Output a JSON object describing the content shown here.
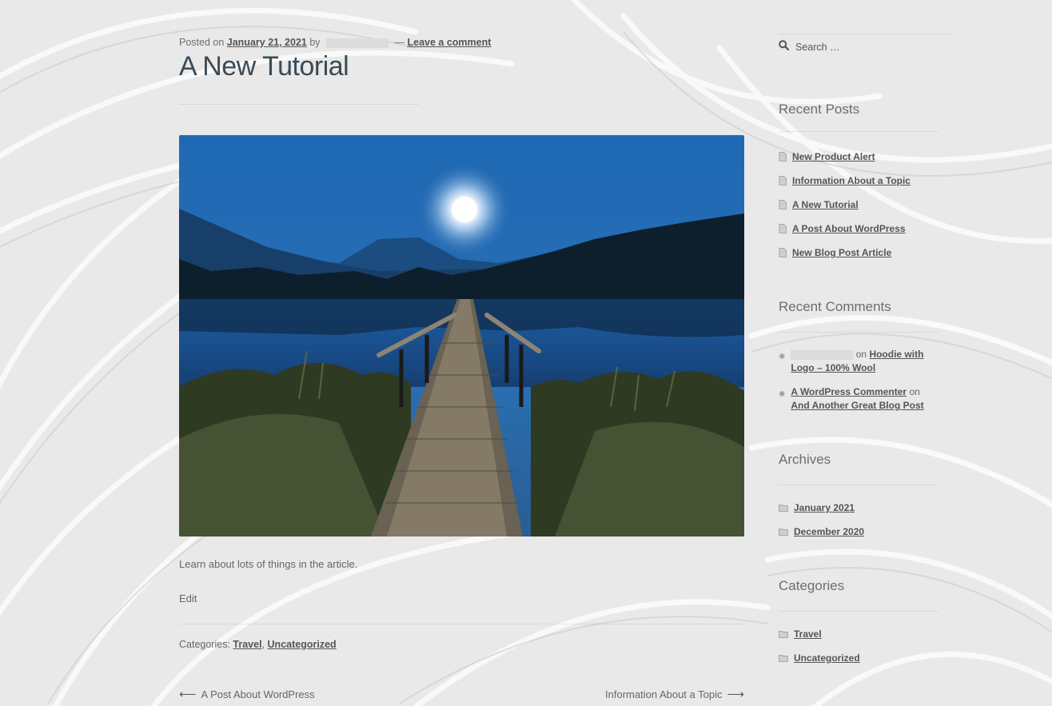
{
  "post": {
    "meta": {
      "posted_on": "Posted on",
      "date": "January 21, 2021",
      "by": "by",
      "dash": "—",
      "comment_link": "Leave a comment"
    },
    "title": "A New Tutorial",
    "excerpt": "Learn about lots of things in the article.",
    "edit_label": "Edit",
    "categories_label": "Categories:",
    "categories": [
      "Travel",
      "Uncategorized"
    ],
    "categories_sep": ",",
    "nav": {
      "prev_label": "A Post About WordPress",
      "next_label": "Information About a Topic"
    }
  },
  "sidebar": {
    "search": {
      "placeholder": "Search …"
    },
    "recent_posts": {
      "title": "Recent Posts",
      "items": [
        "New Product Alert",
        "Information About a Topic",
        "A New Tutorial",
        "A Post About WordPress",
        "New Blog Post Article"
      ]
    },
    "recent_comments": {
      "title": "Recent Comments",
      "on": "on",
      "items": [
        {
          "author": "",
          "post": "Hoodie with Logo – 100% Wool"
        },
        {
          "author": "A WordPress Commenter",
          "post": "And Another Great Blog Post"
        }
      ]
    },
    "archives": {
      "title": "Archives",
      "items": [
        "January 2021",
        "December 2020"
      ]
    },
    "categories": {
      "title": "Categories",
      "items": [
        "Travel",
        "Uncategorized"
      ]
    }
  },
  "colors": {
    "background": "#e8e8e8",
    "title_text": "#3a4a56",
    "link_text": "#555555"
  }
}
